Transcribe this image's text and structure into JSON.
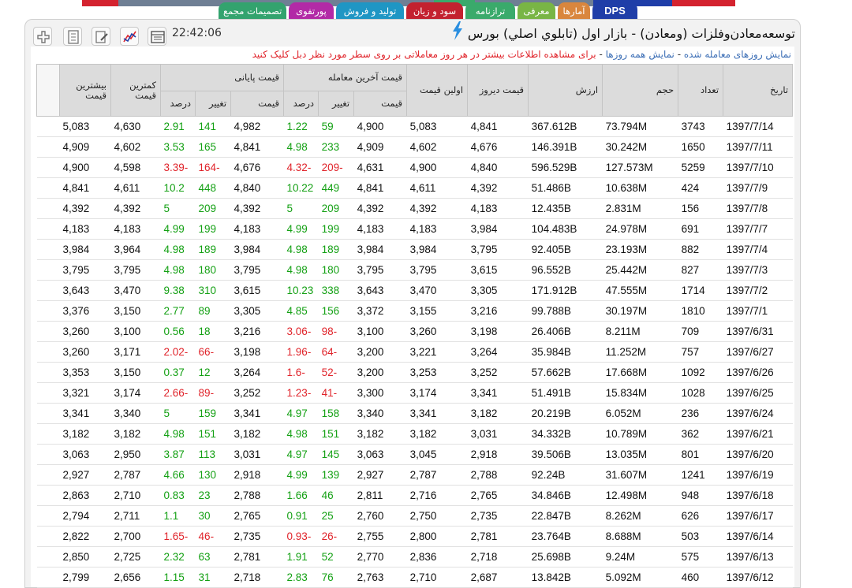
{
  "colors": {
    "accent_bar_blue": "#1f3ea8",
    "positive": "#13a013",
    "negative": "#e0232a",
    "link": "#3d6fb6"
  },
  "tabs": [
    {
      "label": "DPS",
      "color": "#1f3ea8"
    },
    {
      "label": "آمارها",
      "color": "#d9863d"
    },
    {
      "label": "معرفی",
      "color": "#79b545"
    },
    {
      "label": "ترازنامه",
      "color": "#3aaa6b"
    },
    {
      "label": "سود و زیان",
      "color": "#c3212f"
    },
    {
      "label": "تولید و فروش",
      "color": "#1f96c4"
    },
    {
      "label": "پورتفوی",
      "color": "#b22aa6"
    },
    {
      "label": "تصمیمات مجمع",
      "color": "#33a36e"
    }
  ],
  "header": {
    "title": "توسعه‌معادن‌وفلزات (ومعادن) - بازار اول (تابلوي اصلي) بورس",
    "clock": "22:42:06",
    "icons": [
      "table-icon",
      "chart-icon",
      "edit-icon",
      "document-icon",
      "add-icon"
    ]
  },
  "info": {
    "link1": "نمایش روزهای معامله شده",
    "separator1": " - ",
    "link2": "نمایش همه روزها",
    "separator2": " - ",
    "note": "برای مشاهده اطلاعات بیشتر در هر روز معاملاتی بر روی سطر مورد نظر دبل کلیک کنید"
  },
  "table": {
    "headers": {
      "date": "تاریخ",
      "count": "تعداد",
      "volume": "حجم",
      "value": "ارزش",
      "prev_price": "قیمت دیروز",
      "first_price": "اولین قیمت",
      "last_trade": "قیمت آخرین معامله",
      "closing": "قیمت پایانی",
      "price": "قیمت",
      "change": "تغییر",
      "percent": "درصد",
      "min": "کمترین قیمت",
      "max": "بیشترین قیمت"
    },
    "rows": [
      [
        "1397/7/14",
        "3743",
        "73.794M",
        "367.612B",
        "4,841",
        "5,083",
        "4,900",
        "59",
        "1.22",
        "4,982",
        "141",
        "2.91",
        "4,630",
        "5,083"
      ],
      [
        "1397/7/11",
        "1650",
        "30.242M",
        "146.391B",
        "4,676",
        "4,602",
        "4,909",
        "233",
        "4.98",
        "4,841",
        "165",
        "3.53",
        "4,602",
        "4,909"
      ],
      [
        "1397/7/10",
        "5259",
        "127.573M",
        "596.529B",
        "4,840",
        "4,900",
        "4,631",
        "-209",
        "-4.32",
        "4,676",
        "-164",
        "-3.39",
        "4,598",
        "4,900"
      ],
      [
        "1397/7/9",
        "424",
        "10.638M",
        "51.486B",
        "4,392",
        "4,611",
        "4,841",
        "449",
        "10.22",
        "4,840",
        "448",
        "10.2",
        "4,611",
        "4,841"
      ],
      [
        "1397/7/8",
        "156",
        "2.831M",
        "12.435B",
        "4,183",
        "4,392",
        "4,392",
        "209",
        "5",
        "4,392",
        "209",
        "5",
        "4,392",
        "4,392"
      ],
      [
        "1397/7/7",
        "691",
        "24.978M",
        "104.483B",
        "3,984",
        "4,183",
        "4,183",
        "199",
        "4.99",
        "4,183",
        "199",
        "4.99",
        "4,183",
        "4,183"
      ],
      [
        "1397/7/4",
        "882",
        "23.193M",
        "92.405B",
        "3,795",
        "3,984",
        "3,984",
        "189",
        "4.98",
        "3,984",
        "189",
        "4.98",
        "3,964",
        "3,984"
      ],
      [
        "1397/7/3",
        "827",
        "25.442M",
        "96.552B",
        "3,615",
        "3,795",
        "3,795",
        "180",
        "4.98",
        "3,795",
        "180",
        "4.98",
        "3,795",
        "3,795"
      ],
      [
        "1397/7/2",
        "1714",
        "47.555M",
        "171.912B",
        "3,305",
        "3,470",
        "3,643",
        "338",
        "10.23",
        "3,615",
        "310",
        "9.38",
        "3,470",
        "3,643"
      ],
      [
        "1397/7/1",
        "1810",
        "30.197M",
        "99.788B",
        "3,216",
        "3,155",
        "3,372",
        "156",
        "4.85",
        "3,305",
        "89",
        "2.77",
        "3,150",
        "3,376"
      ],
      [
        "1397/6/31",
        "709",
        "8.211M",
        "26.406B",
        "3,198",
        "3,260",
        "3,100",
        "-98",
        "-3.06",
        "3,216",
        "18",
        "0.56",
        "3,100",
        "3,260"
      ],
      [
        "1397/6/27",
        "757",
        "11.252M",
        "35.984B",
        "3,264",
        "3,221",
        "3,200",
        "-64",
        "-1.96",
        "3,198",
        "-66",
        "-2.02",
        "3,171",
        "3,260"
      ],
      [
        "1397/6/26",
        "1092",
        "17.668M",
        "57.662B",
        "3,252",
        "3,253",
        "3,200",
        "-52",
        "-1.6",
        "3,264",
        "12",
        "0.37",
        "3,150",
        "3,353"
      ],
      [
        "1397/6/25",
        "1028",
        "15.834M",
        "51.491B",
        "3,341",
        "3,174",
        "3,300",
        "-41",
        "-1.23",
        "3,252",
        "-89",
        "-2.66",
        "3,174",
        "3,321"
      ],
      [
        "1397/6/24",
        "236",
        "6.052M",
        "20.219B",
        "3,182",
        "3,341",
        "3,340",
        "158",
        "4.97",
        "3,341",
        "159",
        "5",
        "3,340",
        "3,341"
      ],
      [
        "1397/6/21",
        "362",
        "10.789M",
        "34.332B",
        "3,031",
        "3,182",
        "3,182",
        "151",
        "4.98",
        "3,182",
        "151",
        "4.98",
        "3,182",
        "3,182"
      ],
      [
        "1397/6/20",
        "801",
        "13.035M",
        "39.506B",
        "2,918",
        "3,045",
        "3,063",
        "145",
        "4.97",
        "3,031",
        "113",
        "3.87",
        "2,950",
        "3,063"
      ],
      [
        "1397/6/19",
        "1241",
        "31.607M",
        "92.24B",
        "2,788",
        "2,787",
        "2,927",
        "139",
        "4.99",
        "2,918",
        "130",
        "4.66",
        "2,787",
        "2,927"
      ],
      [
        "1397/6/18",
        "948",
        "12.498M",
        "34.846B",
        "2,765",
        "2,716",
        "2,811",
        "46",
        "1.66",
        "2,788",
        "23",
        "0.83",
        "2,710",
        "2,863"
      ],
      [
        "1397/6/17",
        "626",
        "8.262M",
        "22.847B",
        "2,735",
        "2,750",
        "2,760",
        "25",
        "0.91",
        "2,765",
        "30",
        "1.1",
        "2,711",
        "2,794"
      ],
      [
        "1397/6/14",
        "503",
        "8.688M",
        "23.764B",
        "2,781",
        "2,800",
        "2,755",
        "-26",
        "-0.93",
        "2,735",
        "-46",
        "-1.65",
        "2,700",
        "2,822"
      ],
      [
        "1397/6/13",
        "575",
        "9.24M",
        "25.698B",
        "2,718",
        "2,836",
        "2,770",
        "52",
        "1.91",
        "2,781",
        "63",
        "2.32",
        "2,725",
        "2,850"
      ],
      [
        "1397/6/12",
        "460",
        "5.092M",
        "13.842B",
        "2,687",
        "2,710",
        "2,763",
        "76",
        "2.83",
        "2,718",
        "31",
        "1.15",
        "2,656",
        "2,799"
      ]
    ]
  }
}
